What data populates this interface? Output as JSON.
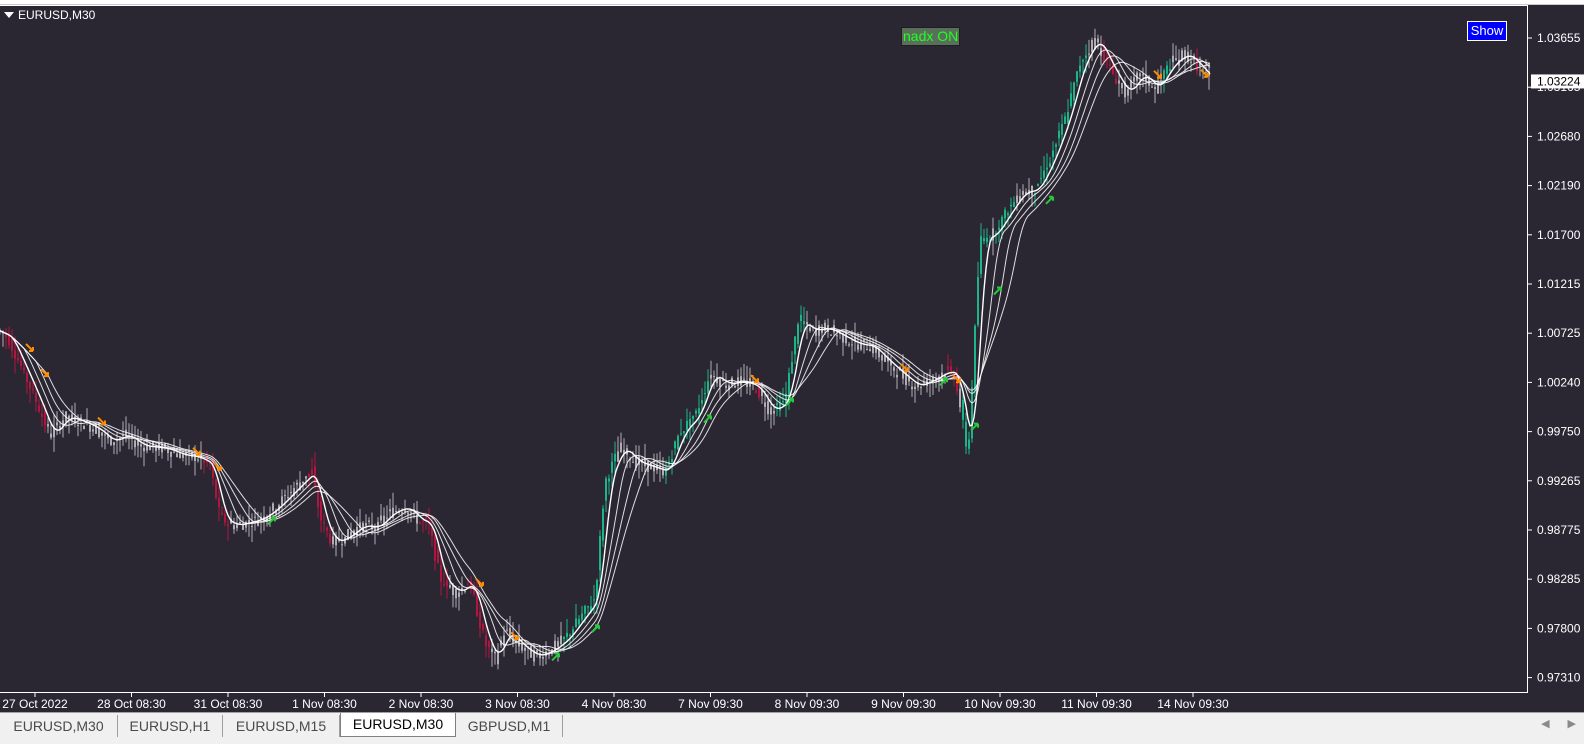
{
  "window": {
    "symbol_title": "EURUSD,M30"
  },
  "overlays": {
    "nadx_label": "nadx ON",
    "show_button": "Show"
  },
  "tabs": [
    {
      "label": "EURUSD,M30",
      "active": false
    },
    {
      "label": "EURUSD,H1",
      "active": false
    },
    {
      "label": "EURUSD,M15",
      "active": false
    },
    {
      "label": "EURUSD,M30",
      "active": true
    },
    {
      "label": "GBPUSD,M1",
      "active": false
    }
  ],
  "colors": {
    "background": "#2a2733",
    "bull": "#1db487",
    "bear": "#b0163f",
    "neutral": "#b0aeb4",
    "ma_lines": "#ffffff",
    "arrow_up": "#28c83c",
    "arrow_down": "#ff8c00",
    "price_marker_bg": "#ffffff"
  },
  "chart_data": {
    "type": "candlestick",
    "symbol": "EURUSD",
    "timeframe": "M30",
    "y_ticks": [
      "1.03655",
      "1.03165",
      "1.02680",
      "1.02190",
      "1.01700",
      "1.01215",
      "1.00725",
      "1.00240",
      "0.99750",
      "0.99265",
      "0.98775",
      "0.98285",
      "0.97800",
      "0.97310"
    ],
    "current_price": "1.03224",
    "ylim": [
      0.9705,
      1.0395
    ],
    "x_ticks": [
      "27 Oct 2022",
      "28 Oct 08:30",
      "31 Oct 08:30",
      "1 Nov 08:30",
      "2 Nov 08:30",
      "3 Nov 08:30",
      "4 Nov 08:30",
      "7 Nov 09:30",
      "8 Nov 09:30",
      "9 Nov 09:30",
      "10 Nov 09:30",
      "11 Nov 09:30",
      "14 Nov 09:30"
    ],
    "grid": false,
    "series": [
      {
        "name": "close",
        "points": [
          [
            0,
            1.0075
          ],
          [
            8,
            1.0068
          ],
          [
            20,
            1.0042
          ],
          [
            35,
            1.0008
          ],
          [
            50,
            0.9971
          ],
          [
            65,
            0.999
          ],
          [
            80,
            0.9985
          ],
          [
            95,
            0.9978
          ],
          [
            110,
            0.9965
          ],
          [
            125,
            0.9972
          ],
          [
            140,
            0.9961
          ],
          [
            150,
            0.996
          ],
          [
            165,
            0.9958
          ],
          [
            180,
            0.9952
          ],
          [
            195,
            0.995
          ],
          [
            210,
            0.9942
          ],
          [
            220,
            0.989
          ],
          [
            232,
            0.9882
          ],
          [
            248,
            0.9885
          ],
          [
            262,
            0.989
          ],
          [
            275,
            0.99
          ],
          [
            290,
            0.9915
          ],
          [
            305,
            0.993
          ],
          [
            312,
            0.9935
          ],
          [
            320,
            0.989
          ],
          [
            332,
            0.9865
          ],
          [
            345,
            0.987
          ],
          [
            360,
            0.9882
          ],
          [
            375,
            0.988
          ],
          [
            390,
            0.9895
          ],
          [
            405,
            0.99
          ],
          [
            420,
            0.9885
          ],
          [
            428,
            0.9885
          ],
          [
            440,
            0.983
          ],
          [
            455,
            0.9815
          ],
          [
            470,
            0.9825
          ],
          [
            485,
            0.9765
          ],
          [
            495,
            0.975
          ],
          [
            505,
            0.9778
          ],
          [
            520,
            0.9762
          ],
          [
            535,
            0.9752
          ],
          [
            550,
            0.9758
          ],
          [
            565,
            0.977
          ],
          [
            580,
            0.979
          ],
          [
            595,
            0.981
          ],
          [
            605,
            0.9925
          ],
          [
            620,
            0.996
          ],
          [
            635,
            0.9945
          ],
          [
            650,
            0.994
          ],
          [
            665,
            0.9935
          ],
          [
            680,
            0.9975
          ],
          [
            695,
            0.999
          ],
          [
            710,
            1.0032
          ],
          [
            725,
            1.0022
          ],
          [
            740,
            1.0025
          ],
          [
            755,
            1.002
          ],
          [
            770,
            0.9995
          ],
          [
            785,
            1.0005
          ],
          [
            798,
            1.0085
          ],
          [
            812,
            1.0075
          ],
          [
            825,
            1.0078
          ],
          [
            840,
            1.007
          ],
          [
            855,
            1.0062
          ],
          [
            870,
            1.006
          ],
          [
            885,
            1.0045
          ],
          [
            900,
            1.0032
          ],
          [
            915,
            1.002
          ],
          [
            930,
            1.0026
          ],
          [
            945,
            1.0035
          ],
          [
            955,
            1.0032
          ],
          [
            968,
            0.995
          ],
          [
            980,
            1.0165
          ],
          [
            992,
            1.017
          ],
          [
            1005,
            1.019
          ],
          [
            1020,
            1.0212
          ],
          [
            1035,
            1.0215
          ],
          [
            1050,
            1.0245
          ],
          [
            1065,
            1.0285
          ],
          [
            1080,
            1.034
          ],
          [
            1095,
            1.0365
          ],
          [
            1110,
            1.0335
          ],
          [
            1125,
            1.031
          ],
          [
            1140,
            1.033
          ],
          [
            1155,
            1.0315
          ],
          [
            1170,
            1.034
          ],
          [
            1185,
            1.035
          ],
          [
            1200,
            1.0335
          ],
          [
            1210,
            1.0322
          ]
        ]
      }
    ],
    "signals": {
      "up_arrows": [
        [
          272,
          0.9887
        ],
        [
          556,
          0.9752
        ],
        [
          596,
          0.978
        ],
        [
          708,
          0.9988
        ],
        [
          790,
          1.0005
        ],
        [
          944,
          1.0025
        ],
        [
          975,
          0.998
        ],
        [
          998,
          1.0115
        ],
        [
          1050,
          1.0205
        ]
      ],
      "down_arrows": [
        [
          30,
          1.0058
        ],
        [
          45,
          1.0033
        ],
        [
          102,
          0.9985
        ],
        [
          197,
          0.9955
        ],
        [
          218,
          0.994
        ],
        [
          480,
          0.9825
        ],
        [
          515,
          0.9772
        ],
        [
          755,
          1.0027
        ],
        [
          905,
          1.0038
        ],
        [
          957,
          1.0027
        ],
        [
          1158,
          1.0329
        ],
        [
          1205,
          1.033
        ]
      ]
    }
  }
}
